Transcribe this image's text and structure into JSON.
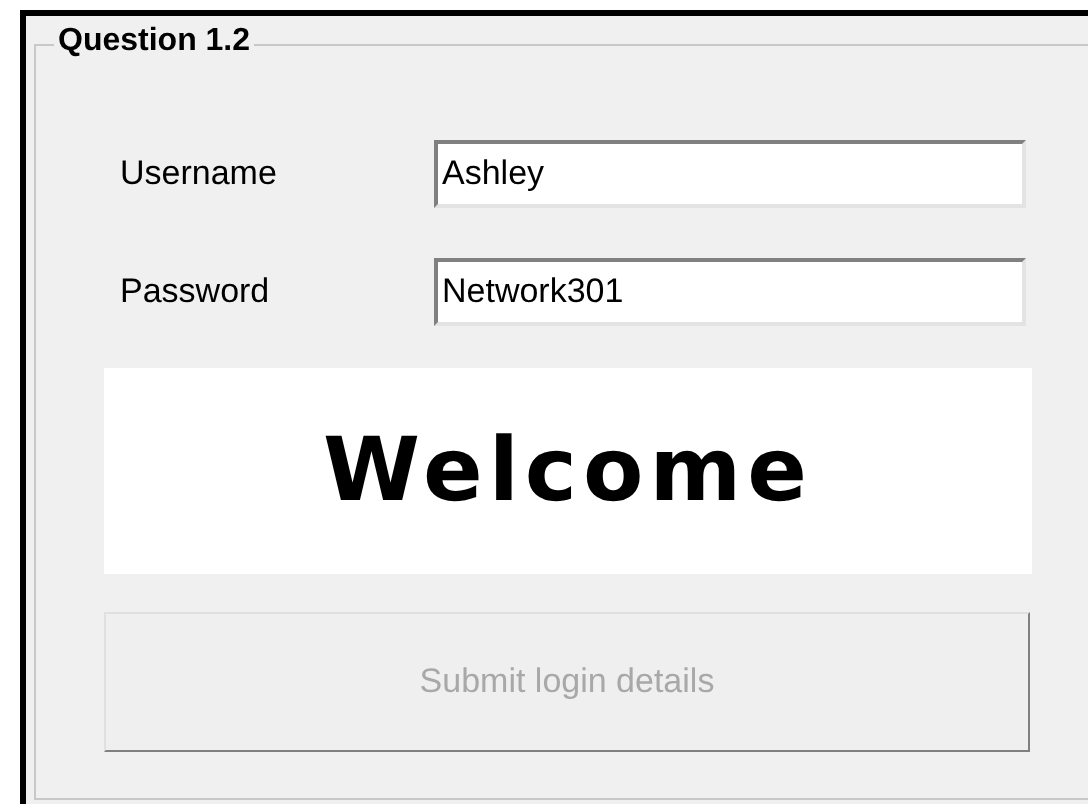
{
  "group": {
    "title": "Question 1.2"
  },
  "fields": [
    {
      "label": "Username",
      "value": "Ashley"
    },
    {
      "label": "Password",
      "value": "Network301"
    }
  ],
  "banner": {
    "text": "Welcome"
  },
  "submit_button": {
    "label": "Submit login details",
    "disabled": true
  }
}
